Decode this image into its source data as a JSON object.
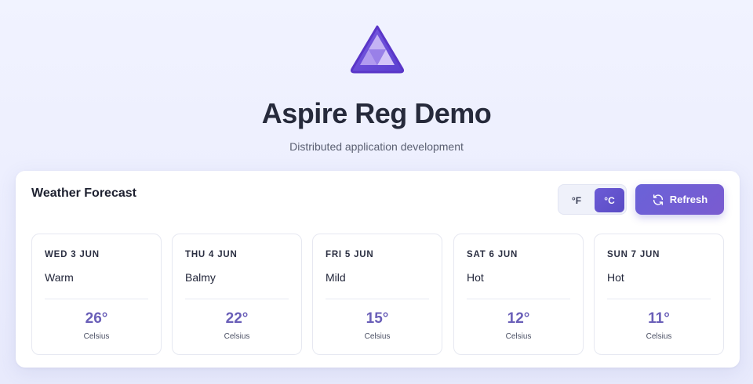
{
  "app": {
    "title": "Aspire Reg Demo",
    "subtitle": "Distributed application development",
    "logo_icon": "aspire-triangle-logo"
  },
  "forecast": {
    "title": "Weather Forecast",
    "units": {
      "fahrenheit_label": "°F",
      "celsius_label": "°C",
      "selected": "°C"
    },
    "refresh": {
      "label": "Refresh",
      "icon": "refresh-icon"
    },
    "days": [
      {
        "date": "WED 3 JUN",
        "summary": "Warm",
        "temp": "26°",
        "unit": "Celsius"
      },
      {
        "date": "THU 4 JUN",
        "summary": "Balmy",
        "temp": "22°",
        "unit": "Celsius"
      },
      {
        "date": "FRI 5 JUN",
        "summary": "Mild",
        "temp": "15°",
        "unit": "Celsius"
      },
      {
        "date": "SAT 6 JUN",
        "summary": "Hot",
        "temp": "12°",
        "unit": "Celsius"
      },
      {
        "date": "SUN 7 JUN",
        "summary": "Hot",
        "temp": "11°",
        "unit": "Celsius"
      }
    ]
  },
  "colors": {
    "accent": "#6a5fd0",
    "temp": "#6a5fb8",
    "background": "#eef0fd"
  }
}
